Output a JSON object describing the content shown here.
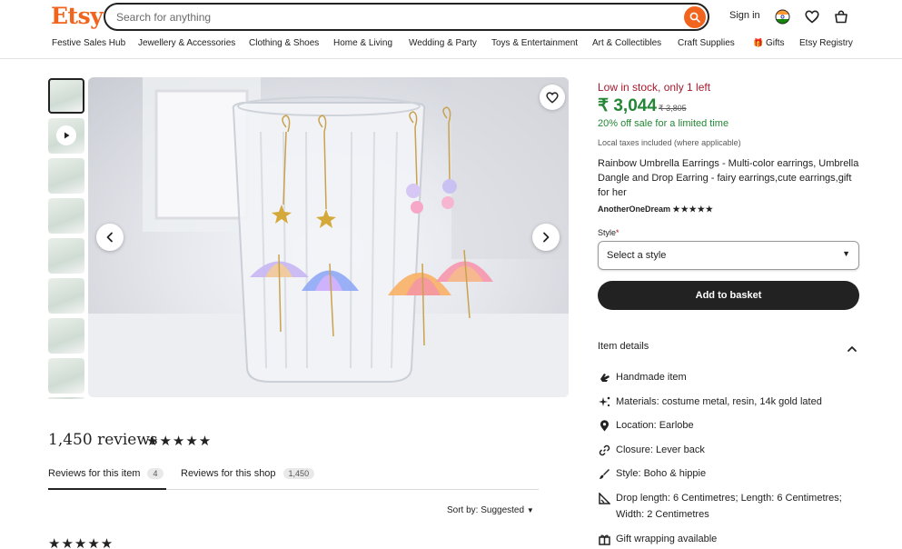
{
  "header": {
    "logo": "Etsy",
    "search_placeholder": "Search for anything",
    "signin": "Sign in"
  },
  "categories": [
    "Festive Sales Hub",
    "Jewellery & Accessories",
    "Clothing & Shoes",
    "Home & Living",
    "Wedding & Party",
    "Toys & Entertainment",
    "Art & Collectibles",
    "Craft Supplies",
    "Gifts",
    "Etsy Registry"
  ],
  "reviews": {
    "title": "1,450 reviews",
    "tab_item": "Reviews for this item",
    "tab_item_count": "4",
    "tab_shop": "Reviews for this shop",
    "tab_shop_count": "1,450",
    "sort": "Sort by: Suggested",
    "stars": "★★★★★"
  },
  "product": {
    "stock": "Low in stock, only 1 left",
    "price": "₹ 3,044",
    "old_price": "₹ 3,805",
    "sale": "20% off sale for a limited time",
    "taxes": "Local taxes included (where applicable)",
    "title": "Rainbow Umbrella Earrings - Multi-color earrings, Umbrella Dangle and Drop Earring - fairy earrings,cute earrings,gift for her",
    "shop": "AnotherOneDream",
    "shop_stars": "★★★★★",
    "style_label": "Style",
    "style_required": "*",
    "style_select": "Select a style",
    "add_to_basket": "Add to basket",
    "item_details": "Item details",
    "details": [
      "Handmade item",
      "Materials: costume metal, resin, 14k gold lated",
      "Location: Earlobe",
      "Closure: Lever back",
      "Style: Boho & hippie",
      "Drop length: 6 Centimetres; Length: 6 Centimetres; Width: 2 Centimetres",
      "Gift wrapping available"
    ]
  },
  "colors": {
    "brand": "#f1641e",
    "price_green": "#258635",
    "stock_red": "#a61a2e"
  }
}
